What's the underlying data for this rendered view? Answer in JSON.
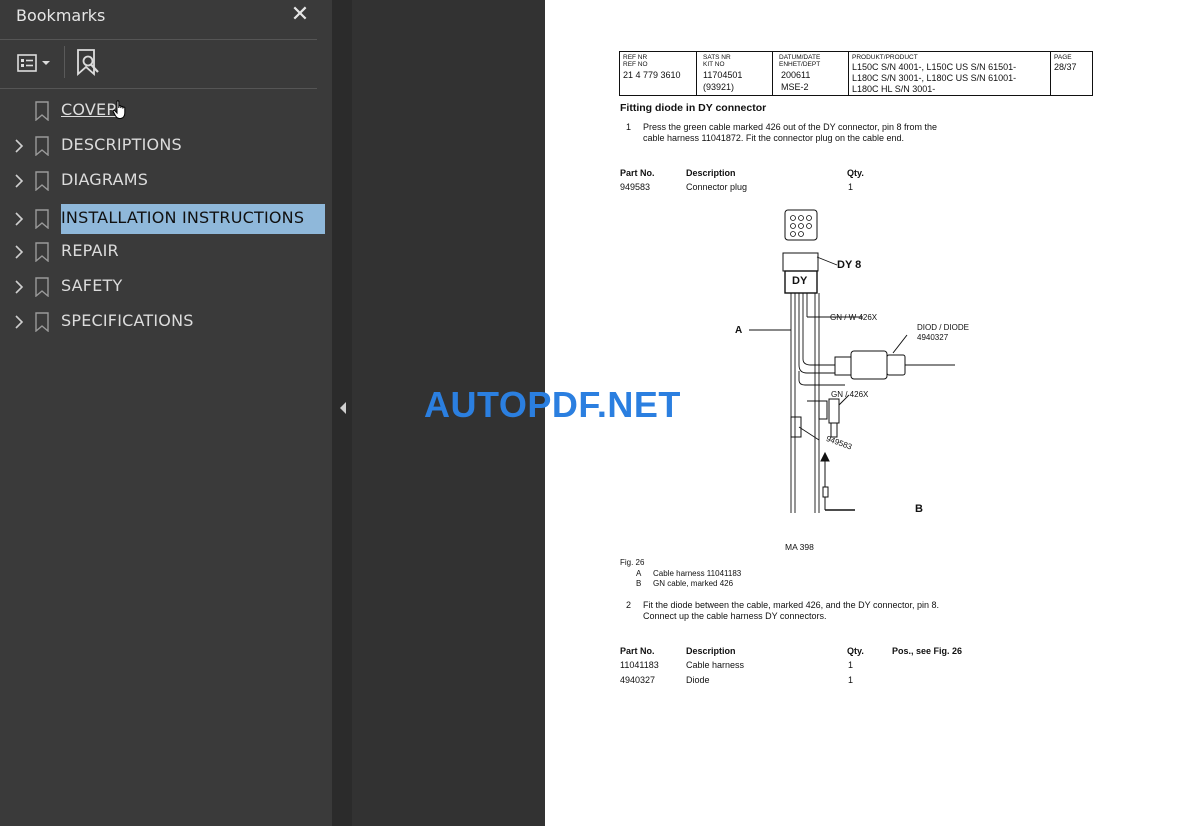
{
  "sidebar": {
    "title": "Bookmarks",
    "close_symbol": "✕",
    "items": [
      {
        "label": "COVER",
        "expandable": false
      },
      {
        "label": "DESCRIPTIONS",
        "expandable": true
      },
      {
        "label": "DIAGRAMS",
        "expandable": true
      },
      {
        "label": "INSTALLATION INSTRUCTIONS",
        "expandable": true,
        "selected": true
      },
      {
        "label": "REPAIR",
        "expandable": true
      },
      {
        "label": "SAFETY",
        "expandable": true
      },
      {
        "label": "SPECIFICATIONS",
        "expandable": true
      }
    ]
  },
  "icons": {
    "options": "bookmark-options-icon",
    "find": "find-bookmark-icon",
    "bookmark": "bookmark-icon",
    "chevron": "chevron-right-icon",
    "collapse": "collapse-left-icon",
    "cursor": "hand-pointer-icon"
  },
  "colors": {
    "sidebar_bg": "#3a3a3a",
    "selection": "#8fb8da",
    "viewer_bg": "#323232",
    "watermark": "#2b7fe0"
  },
  "document": {
    "header": {
      "ref_label1": "REF NR",
      "ref_label2": "REF NO",
      "ref_value": "21 4 779 3610",
      "sats_label1": "SATS NR",
      "sats_label2": "KIT NO",
      "sats_value1": "11704501",
      "sats_value2": "(93921)",
      "datum_label1": "DATUM/DATE",
      "datum_label2": "ENHET/DEPT",
      "datum_value1": "200611",
      "datum_value2": "MSE-2",
      "product_label": "PRODUKT/PRODUCT",
      "product_line1": "L150C S/N 4001-, L150C US S/N 61501-",
      "product_line2": "L180C S/N 3001-, L180C US S/N 61001-",
      "product_line3": "L180C HL S/N 3001-",
      "page_label": "PAGE",
      "page_value": "28/37"
    },
    "section_title": "Fitting diode in DY connector",
    "step1_num": "1",
    "step1_line1": "Press the green cable marked 426 out of the DY connector, pin 8 from the",
    "step1_line2": "cable harness 11041872. Fit the connector plug on the cable end.",
    "table1": {
      "headers": [
        "Part No.",
        "Description",
        "Qty."
      ],
      "rows": [
        [
          "949583",
          "Connector plug",
          "1"
        ]
      ]
    },
    "figure": {
      "label_dy8": "DY 8",
      "label_dy": "DY",
      "label_a": "A",
      "label_gnw": "GN / W   426X",
      "label_diod": "DIOD / DIODE",
      "label_diode_no": "4940327",
      "label_gn": "GN /   426X",
      "label_plug": "949583",
      "label_b": "B",
      "caption_code": "MA 398"
    },
    "fig_caption": {
      "title": "Fig. 26",
      "a_key": "A",
      "a_text": "Cable harness 11041183",
      "b_key": "B",
      "b_text": "GN cable, marked 426"
    },
    "step2_num": "2",
    "step2_line1": "Fit the diode between the cable, marked 426, and the DY connector, pin 8.",
    "step2_line2": "Connect up the cable harness DY connectors.",
    "table2": {
      "headers": [
        "Part No.",
        "Description",
        "Qty.",
        "Pos., see Fig. 26"
      ],
      "rows": [
        [
          "11041183",
          "Cable harness",
          "1"
        ],
        [
          "4940327",
          "Diode",
          "1"
        ]
      ]
    }
  },
  "watermark": "AUTOPDF.NET"
}
